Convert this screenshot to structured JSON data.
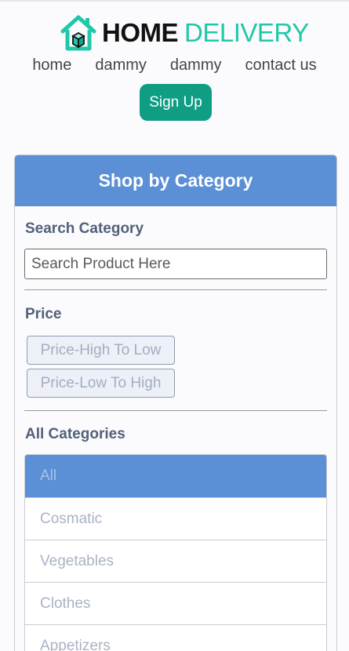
{
  "brand": {
    "name_part1": "HOME",
    "name_part2": "DELIVERY"
  },
  "nav": {
    "items": [
      "home",
      "dammy",
      "dammy",
      "contact us"
    ]
  },
  "auth": {
    "signup_label": "Sign Up"
  },
  "panel": {
    "title": "Shop by Category",
    "search": {
      "label": "Search Category",
      "placeholder": "Search Product Here"
    },
    "price": {
      "label": "Price",
      "options": [
        "Price-High To Low",
        "Price-Low To High"
      ]
    },
    "categories": {
      "label": "All Categories",
      "items": [
        "All",
        "Cosmatic",
        "Vegetables",
        "Clothes",
        "Appetizers"
      ],
      "selected": "All"
    }
  },
  "colors": {
    "accent": "#5b8fd6",
    "brand_teal": "#1ec8a8",
    "signup_bg": "#0f9d84"
  },
  "icons": {
    "logo": "house-box-icon"
  }
}
